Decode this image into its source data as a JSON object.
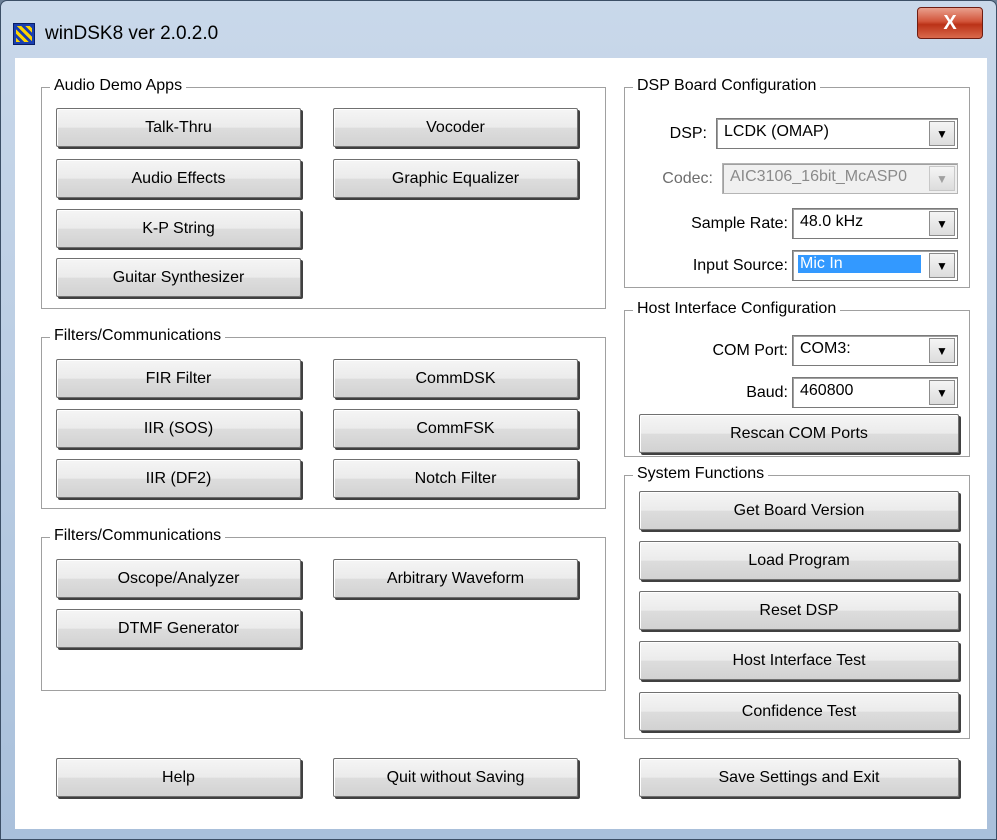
{
  "window": {
    "title": "winDSK8  ver 2.0.2.0",
    "close_glyph": "X"
  },
  "audio_demo": {
    "title": "Audio Demo Apps",
    "buttons": [
      "Talk-Thru",
      "Vocoder",
      "Audio Effects",
      "Graphic Equalizer",
      "K-P String",
      "Guitar Synthesizer"
    ]
  },
  "filters": {
    "title": "Filters/Communications",
    "buttons": [
      "FIR Filter",
      "CommDSK",
      "IIR (SOS)",
      "CommFSK",
      "IIR (DF2)",
      "Notch Filter"
    ]
  },
  "generators": {
    "title": "Filters/Communications",
    "buttons": [
      "Oscope/Analyzer",
      "Arbitrary Waveform",
      "DTMF Generator"
    ]
  },
  "dsp_config": {
    "title": "DSP Board Configuration",
    "dsp_label": "DSP:",
    "dsp_value": "LCDK (OMAP)",
    "codec_label": "Codec:",
    "codec_value": "AIC3106_16bit_McASP0",
    "rate_label": "Sample Rate:",
    "rate_value": "48.0 kHz",
    "input_label": "Input Source:",
    "input_value": "Mic In"
  },
  "host_config": {
    "title": "Host Interface Configuration",
    "com_label": "COM Port:",
    "com_value": "COM3:",
    "baud_label": "Baud:",
    "baud_value": "460800",
    "rescan": "Rescan COM Ports"
  },
  "system": {
    "title": "System Functions",
    "buttons": [
      "Get Board Version",
      "Load Program",
      "Reset DSP",
      "Host Interface Test",
      "Confidence Test"
    ]
  },
  "footer": {
    "help": "Help",
    "quit": "Quit without Saving",
    "save": "Save Settings and Exit"
  },
  "colors": {
    "selection": "#3399ff",
    "close": "#c9432a"
  },
  "icons": {
    "app": "windsk-app-icon",
    "combo": "dropdown-arrow-icon"
  }
}
